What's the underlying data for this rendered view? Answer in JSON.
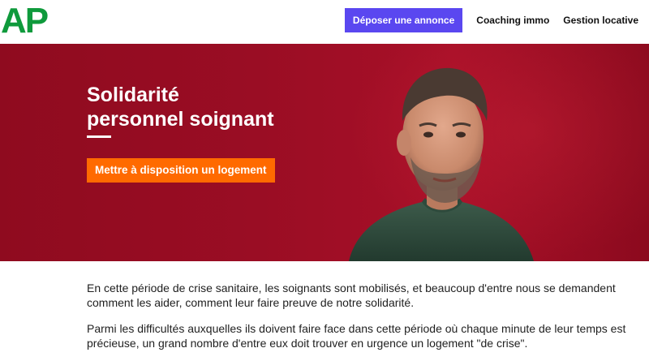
{
  "header": {
    "logo": "AP",
    "cta_label": "Déposer une annonce",
    "nav": [
      "Coaching immo",
      "Gestion locative"
    ]
  },
  "hero": {
    "title_lines": [
      "Solidarité",
      "personnel soignant"
    ],
    "cta_label": "Mettre à disposition un logement"
  },
  "content": {
    "paragraphs": [
      {
        "lines": [
          "En cette période de crise sanitaire, les soignants sont mobilisés, et beaucoup d'entre nous se demandent",
          "comment les aider, comment leur faire preuve de notre solidarité."
        ]
      },
      {
        "lines": [
          "Parmi les difficultés auxquelles ils doivent faire face dans cette période où chaque minute de leur temps est",
          "précieuse, un grand nombre d'entre eux doit trouver en urgence un logement \"de crise\"."
        ]
      }
    ]
  },
  "colors": {
    "brand_green": "#0f9a3c",
    "primary_button": "#5a47f0",
    "hero_background": "#9a0d24",
    "cta_orange": "#ff6a00"
  }
}
